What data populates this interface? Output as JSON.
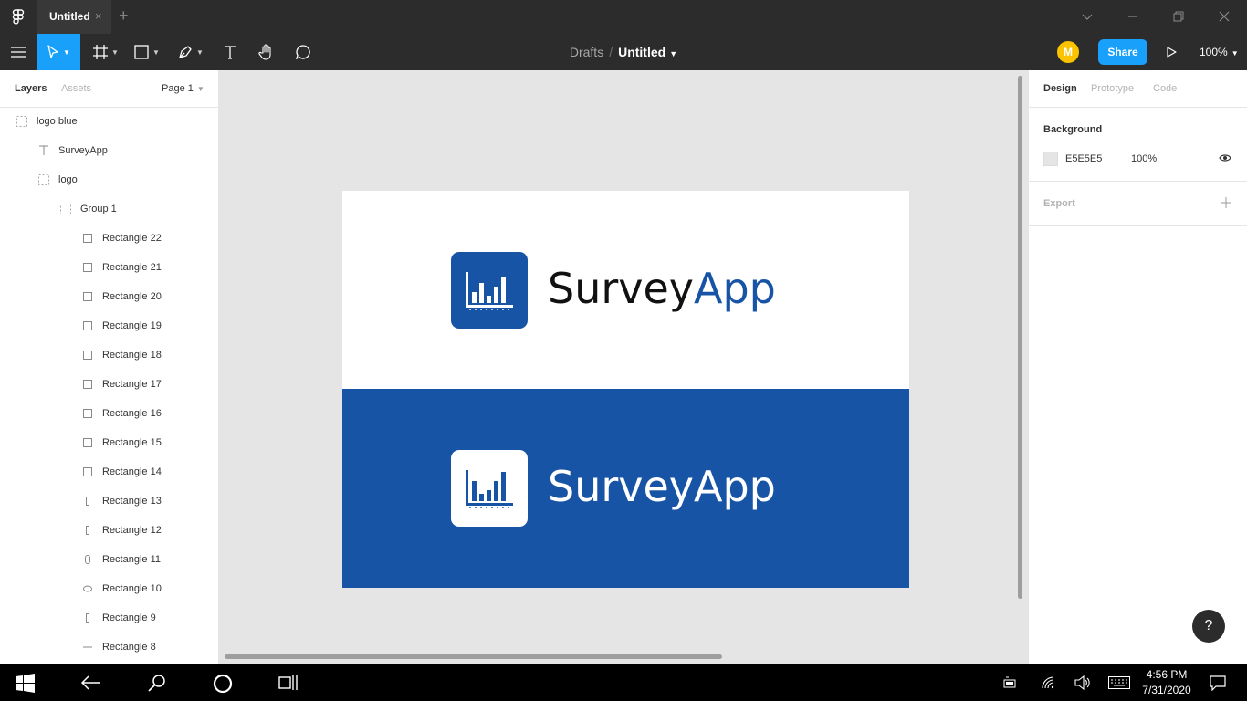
{
  "window": {
    "tab_title": "Untitled",
    "tab_close": "×",
    "tab_add": "+"
  },
  "toolbar": {
    "breadcrumb_drafts": "Drafts",
    "breadcrumb_sep": "/",
    "breadcrumb_file": "Untitled",
    "avatar_initial": "M",
    "share_label": "Share",
    "zoom": "100%"
  },
  "left_panel": {
    "tab_layers": "Layers",
    "tab_assets": "Assets",
    "page": "Page 1",
    "layers": [
      {
        "name": "logo blue",
        "icon": "frame-icon"
      },
      {
        "name": "SurveyApp",
        "icon": "text-icon"
      },
      {
        "name": "logo",
        "icon": "frame-icon"
      },
      {
        "name": "Group 1",
        "icon": "group-icon"
      },
      {
        "name": "Rectangle 22",
        "icon": "rectangle-icon"
      },
      {
        "name": "Rectangle 21",
        "icon": "rectangle-icon"
      },
      {
        "name": "Rectangle 20",
        "icon": "rectangle-icon"
      },
      {
        "name": "Rectangle 19",
        "icon": "rectangle-icon"
      },
      {
        "name": "Rectangle 18",
        "icon": "rectangle-icon"
      },
      {
        "name": "Rectangle 17",
        "icon": "rectangle-icon"
      },
      {
        "name": "Rectangle 16",
        "icon": "rectangle-icon"
      },
      {
        "name": "Rectangle 15",
        "icon": "rectangle-icon"
      },
      {
        "name": "Rectangle 14",
        "icon": "rectangle-icon"
      },
      {
        "name": "Rectangle 13",
        "icon": "thin-rectangle-icon"
      },
      {
        "name": "Rectangle 12",
        "icon": "thin-rectangle-icon"
      },
      {
        "name": "Rectangle 11",
        "icon": "rounded-rectangle-icon"
      },
      {
        "name": "Rectangle 10",
        "icon": "ellipse-icon"
      },
      {
        "name": "Rectangle 9",
        "icon": "thin-rectangle-icon"
      },
      {
        "name": "Rectangle 8",
        "icon": "line-icon"
      }
    ]
  },
  "canvas": {
    "logo_word_part1": "Survey",
    "logo_word_part2": "App",
    "logo_word_full": "SurveyApp",
    "brand_blue": "#1854a6"
  },
  "right_panel": {
    "tab_design": "Design",
    "tab_prototype": "Prototype",
    "tab_code": "Code",
    "background_label": "Background",
    "background_hex": "E5E5E5",
    "background_opacity": "100%",
    "export_label": "Export",
    "help": "?"
  },
  "taskbar": {
    "time": "4:56 PM",
    "date": "7/31/2020"
  }
}
